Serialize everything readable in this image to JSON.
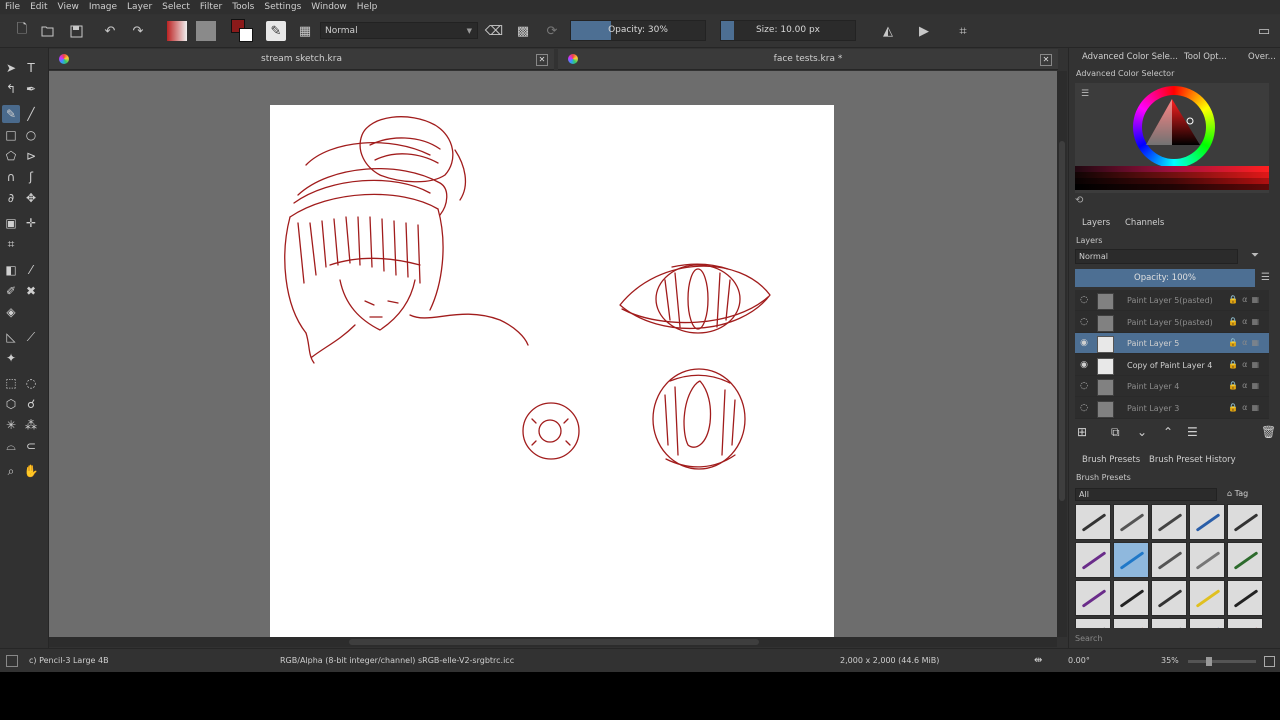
{
  "menu": [
    "File",
    "Edit",
    "View",
    "Image",
    "Layer",
    "Select",
    "Filter",
    "Tools",
    "Settings",
    "Window",
    "Help"
  ],
  "toolbar": {
    "blend_mode": "Normal",
    "opacity_label": "Opacity: 30%",
    "opacity_fraction": 0.3,
    "size_label": "Size: 10.00 px",
    "size_fraction": 0.1
  },
  "colors": {
    "foreground": "#8b1a1a",
    "background": "#ffffff",
    "accent": "#4d6f93",
    "stroke": "#a11c1c"
  },
  "documents": [
    {
      "title": "stream sketch.kra"
    },
    {
      "title": "face tests.kra *"
    }
  ],
  "dock": {
    "top_tabs": [
      "Advanced Color Sele...",
      "Tool Opt...",
      "Over..."
    ],
    "color_selector_title": "Advanced Color Selector",
    "layer_tabs": [
      "Layers",
      "Channels"
    ],
    "layers_title": "Layers",
    "layer_blend": "Normal",
    "layer_opacity": "Opacity:  100%",
    "layers": [
      {
        "name": "Paint Layer 5(pasted)",
        "visible": false,
        "active": false
      },
      {
        "name": "Paint Layer 5(pasted)",
        "visible": false,
        "active": false
      },
      {
        "name": "Paint Layer 5",
        "visible": true,
        "active": true
      },
      {
        "name": "Copy of Paint Layer 4",
        "visible": true,
        "active": false
      },
      {
        "name": "Paint Layer 4",
        "visible": false,
        "active": false
      },
      {
        "name": "Paint Layer 3",
        "visible": false,
        "active": false
      }
    ],
    "brush_tabs": [
      "Brush Presets",
      "Brush Preset History"
    ],
    "brush_presets_title": "Brush Presets",
    "brush_filter": "All",
    "brush_tag": "Tag",
    "brush_search": "Search"
  },
  "status": {
    "brush_name": "c) Pencil-3 Large 4B",
    "color_space": "RGB/Alpha (8-bit integer/channel)  sRGB-elle-V2-srgbtrc.icc",
    "image_size": "2,000 x 2,000 (44.6 MiB)",
    "rotation": "0.00°",
    "zoom": "35%"
  }
}
